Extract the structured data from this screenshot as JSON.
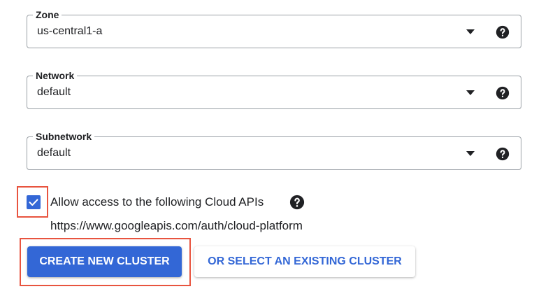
{
  "fields": [
    {
      "label": "Zone",
      "value": "us-central1-a"
    },
    {
      "label": "Network",
      "value": "default"
    },
    {
      "label": "Subnetwork",
      "value": "default"
    }
  ],
  "icons": {
    "dropdown": "triangle-down-icon",
    "help": "question-circle-icon",
    "checkmark": "check-icon"
  },
  "api_access": {
    "checked": true,
    "label": "Allow access to the following Cloud APIs",
    "scope_url": "https://www.googleapis.com/auth/cloud-platform"
  },
  "actions": {
    "create_label": "CREATE NEW CLUSTER",
    "select_existing_label": "OR SELECT AN EXISTING CLUSTER"
  },
  "colors": {
    "accent": "#3367d6",
    "highlight": "#e8543f",
    "text": "#202124",
    "border": "#9aa0a6"
  }
}
